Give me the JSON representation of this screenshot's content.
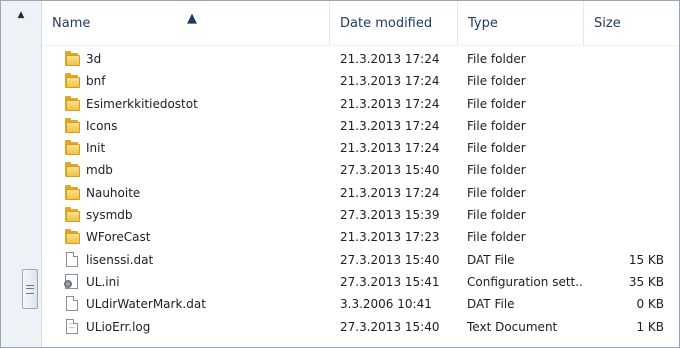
{
  "columns": {
    "name": "Name",
    "date_modified": "Date modified",
    "type": "Type",
    "size": "Size"
  },
  "rows": [
    {
      "name": "3d",
      "date": "21.3.2013 17:24",
      "type": "File folder",
      "size": "",
      "icon": "folder-icon"
    },
    {
      "name": "bnf",
      "date": "21.3.2013 17:24",
      "type": "File folder",
      "size": "",
      "icon": "folder-icon"
    },
    {
      "name": "Esimerkkitiedostot",
      "date": "21.3.2013 17:24",
      "type": "File folder",
      "size": "",
      "icon": "folder-icon"
    },
    {
      "name": "Icons",
      "date": "21.3.2013 17:24",
      "type": "File folder",
      "size": "",
      "icon": "folder-icon"
    },
    {
      "name": "Init",
      "date": "21.3.2013 17:24",
      "type": "File folder",
      "size": "",
      "icon": "folder-icon"
    },
    {
      "name": "mdb",
      "date": "27.3.2013 15:40",
      "type": "File folder",
      "size": "",
      "icon": "folder-icon"
    },
    {
      "name": "Nauhoite",
      "date": "21.3.2013 17:24",
      "type": "File folder",
      "size": "",
      "icon": "folder-icon"
    },
    {
      "name": "sysmdb",
      "date": "27.3.2013 15:39",
      "type": "File folder",
      "size": "",
      "icon": "folder-icon"
    },
    {
      "name": "WForeCast",
      "date": "21.3.2013 17:23",
      "type": "File folder",
      "size": "",
      "icon": "folder-icon"
    },
    {
      "name": "lisenssi.dat",
      "date": "27.3.2013 15:40",
      "type": "DAT File",
      "size": "15 KB",
      "icon": "file-icon"
    },
    {
      "name": "UL.ini",
      "date": "27.3.2013 15:41",
      "type": "Configuration sett...",
      "size": "35 KB",
      "icon": "settings-file-icon"
    },
    {
      "name": "ULdirWaterMark.dat",
      "date": "3.3.2006 10:41",
      "type": "DAT File",
      "size": "0 KB",
      "icon": "file-icon"
    },
    {
      "name": "ULioErr.log",
      "date": "27.3.2013 15:40",
      "type": "Text Document",
      "size": "1 KB",
      "icon": "text-file-icon"
    }
  ],
  "colors": {
    "header_text": "#1f3a5f",
    "folder": "#f2c24b"
  }
}
